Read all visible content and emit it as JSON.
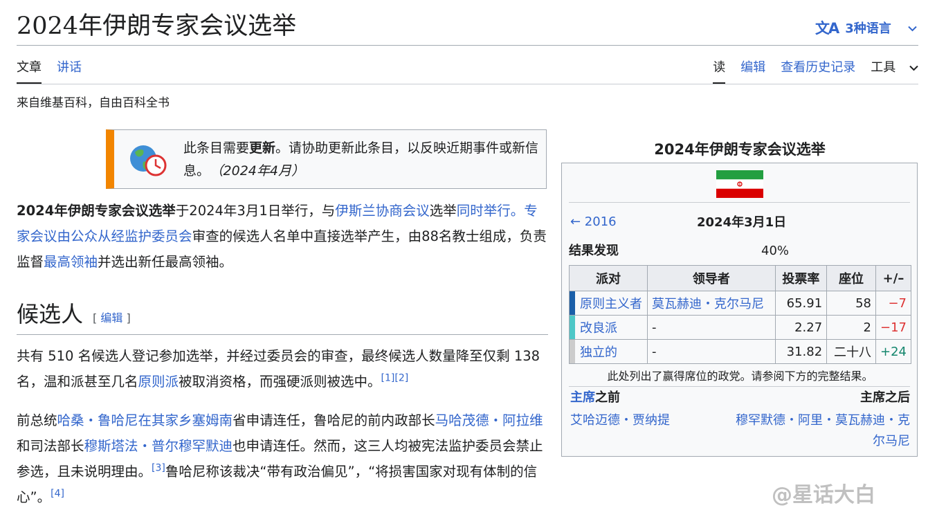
{
  "header": {
    "title": "2024年伊朗专家会议选举",
    "languages_label": "3种语言",
    "languages_icon": "translate-icon"
  },
  "tabs": {
    "article": "文章",
    "talk": "讲话",
    "read": "读",
    "edit": "编辑",
    "history": "查看历史记录",
    "tools": "工具"
  },
  "tagline": "来自维基百科，自由百科全书",
  "ambox": {
    "text_pre": "此条目需要",
    "text_bold": "更新",
    "text_post": "。请协助更新此条目，以反映近期事件或新信息。",
    "date": "（2024年4月）",
    "accent_color": "#f28500"
  },
  "intro": {
    "s1_bold": "2024年伊朗专家会议选举",
    "s1_a": "于2024年3月1日举行，与",
    "s1_link1": "伊斯兰协商会议",
    "s1_b": "选举",
    "s1_link2": "同时举行",
    "s1_c": "。专家会议由",
    "s1_link3": "公众",
    "s1_d": "从经",
    "s1_link4": "监护委员会",
    "s1_e": "审查的候选人名单中直接选举产生，由88名教士组成，负责监督",
    "s1_link5": "最高领袖",
    "s1_f": "并选出新任最高领袖。"
  },
  "section": {
    "heading": "候选人",
    "edit_link": "[ 编辑 ]"
  },
  "para1": {
    "a": "共有 510 名候选人登记参加选举，并经过委员会的审查，最终候选人数量降至仅剩 138 名，温和派甚至几名",
    "link1": "原则派",
    "b": "被取消资格，而强硬派则被选中。",
    "ref1": "[1]",
    "ref2": "[2]"
  },
  "para2": {
    "a": "前总统",
    "link1": "哈桑・鲁哈尼",
    "b": "在其家乡",
    "link2": "塞姆南",
    "c": "省申请连任，鲁哈尼的前内政部长",
    "link3": "马哈茂德・阿拉维",
    "d": "和司法部长",
    "link4": "穆斯塔法・普尔穆罕默迪",
    "e": "也申请连任。然而，这三人均被宪法监护委员会禁止参选，且未说明理由。",
    "ref3": "[3]",
    "f": "鲁哈尼称该裁决“带有政治偏见”，“将损害国家对现有体制的信心”。",
    "ref4": "[4]"
  },
  "infobox": {
    "caption": "2024年伊朗专家会议选举",
    "prev": "← 2016",
    "date": "2024年3月1日",
    "results_label": "结果发现",
    "results_value": "40%",
    "columns": [
      "派对",
      "领导者",
      "投票率",
      "座位",
      "+/–"
    ],
    "rows": [
      {
        "party": "原则主义者",
        "leader": "莫瓦赫迪・克尔马尼",
        "vote": "65.91",
        "seats": "58",
        "change": "−7",
        "color": "#1a5fa8"
      },
      {
        "party": "改良派",
        "leader": "-",
        "vote": "2.27",
        "seats": "2",
        "change": "−17",
        "color": "#4dc7c7"
      },
      {
        "party": "独立的",
        "leader": "-",
        "vote": "31.82",
        "seats": "二十八",
        "change": "+24",
        "color": "#cccccc"
      }
    ],
    "note": "此处列出了赢得席位的政党。请参阅下方的完整结果。",
    "before_link": "主席",
    "before_text": "之前",
    "after_label": "主席之后",
    "before_name": "艾哈迈德・贾纳提",
    "after_name": "穆罕默德・阿里・莫瓦赫迪・克尔马尼"
  },
  "watermark": "@星话大白"
}
